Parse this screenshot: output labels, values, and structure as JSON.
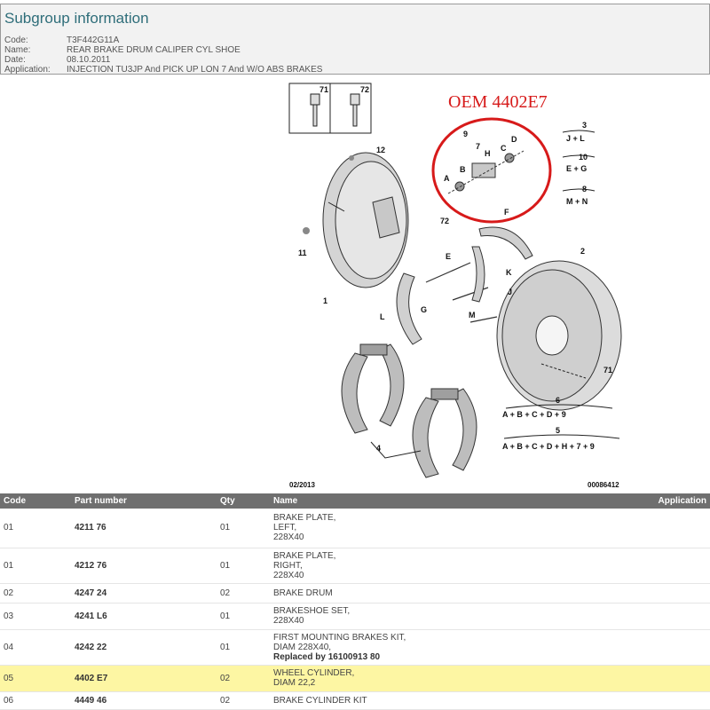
{
  "header": {
    "title": "Subgroup information",
    "fields": [
      {
        "key": "Code:",
        "value": "T3F442G11A"
      },
      {
        "key": "Name:",
        "value": "REAR BRAKE DRUM CALIPER CYL SHOE"
      },
      {
        "key": "Date:",
        "value": "08.10.2011"
      },
      {
        "key": "Application:",
        "value": "INJECTION TU3JP And PICK UP LON 7 And W/O ABS BRAKES"
      }
    ]
  },
  "diagram": {
    "oem_annotation": "OEM  4402E7",
    "annotation_color": "#d71a1a",
    "callouts": [
      "71",
      "72",
      "12",
      "11",
      "1",
      "9",
      "7",
      "B",
      "H",
      "C",
      "D",
      "A",
      "72",
      "E",
      "F",
      "K",
      "J",
      "2",
      "L",
      "G",
      "M",
      "71",
      "4"
    ],
    "formulas": [
      {
        "num": "3",
        "expr": "J + L"
      },
      {
        "num": "10",
        "expr": "E + G"
      },
      {
        "num": "8",
        "expr": "M + N"
      },
      {
        "num": "6",
        "expr": "A + B + C + D + 9"
      },
      {
        "num": "5",
        "expr": "A + B + C + D + H + 7 + 9"
      }
    ],
    "footer_left": "02/2013",
    "footer_right": "00086412"
  },
  "table": {
    "columns": [
      "Code",
      "Part number",
      "Qty",
      "Name",
      "Application"
    ],
    "highlight_color": "#fdf6a3",
    "rows": [
      {
        "code": "01",
        "part": "4211 76",
        "qty": "01",
        "name_lines": [
          "BRAKE PLATE,",
          "LEFT,",
          "228X40"
        ],
        "note": "",
        "highlight": false
      },
      {
        "code": "01",
        "part": "4212 76",
        "qty": "01",
        "name_lines": [
          "BRAKE PLATE,",
          "RIGHT,",
          "228X40"
        ],
        "note": "",
        "highlight": false
      },
      {
        "code": "02",
        "part": "4247 24",
        "qty": "02",
        "name_lines": [
          "BRAKE DRUM"
        ],
        "note": "",
        "highlight": false
      },
      {
        "code": "03",
        "part": "4241 L6",
        "qty": "01",
        "name_lines": [
          "BRAKESHOE SET,",
          "228X40"
        ],
        "note": "",
        "highlight": false
      },
      {
        "code": "04",
        "part": "4242 22",
        "qty": "01",
        "name_lines": [
          "FIRST MOUNTING BRAKES KIT,",
          "DIAM 228X40,"
        ],
        "note": "Replaced by 16100913 80",
        "highlight": false
      },
      {
        "code": "05",
        "part": "4402 E7",
        "qty": "02",
        "name_lines": [
          "WHEEL CYLINDER,",
          "DIAM 22,2"
        ],
        "note": "",
        "highlight": true
      },
      {
        "code": "06",
        "part": "4449 46",
        "qty": "02",
        "name_lines": [
          "BRAKE CYLINDER KIT"
        ],
        "note": "",
        "highlight": false
      }
    ]
  }
}
